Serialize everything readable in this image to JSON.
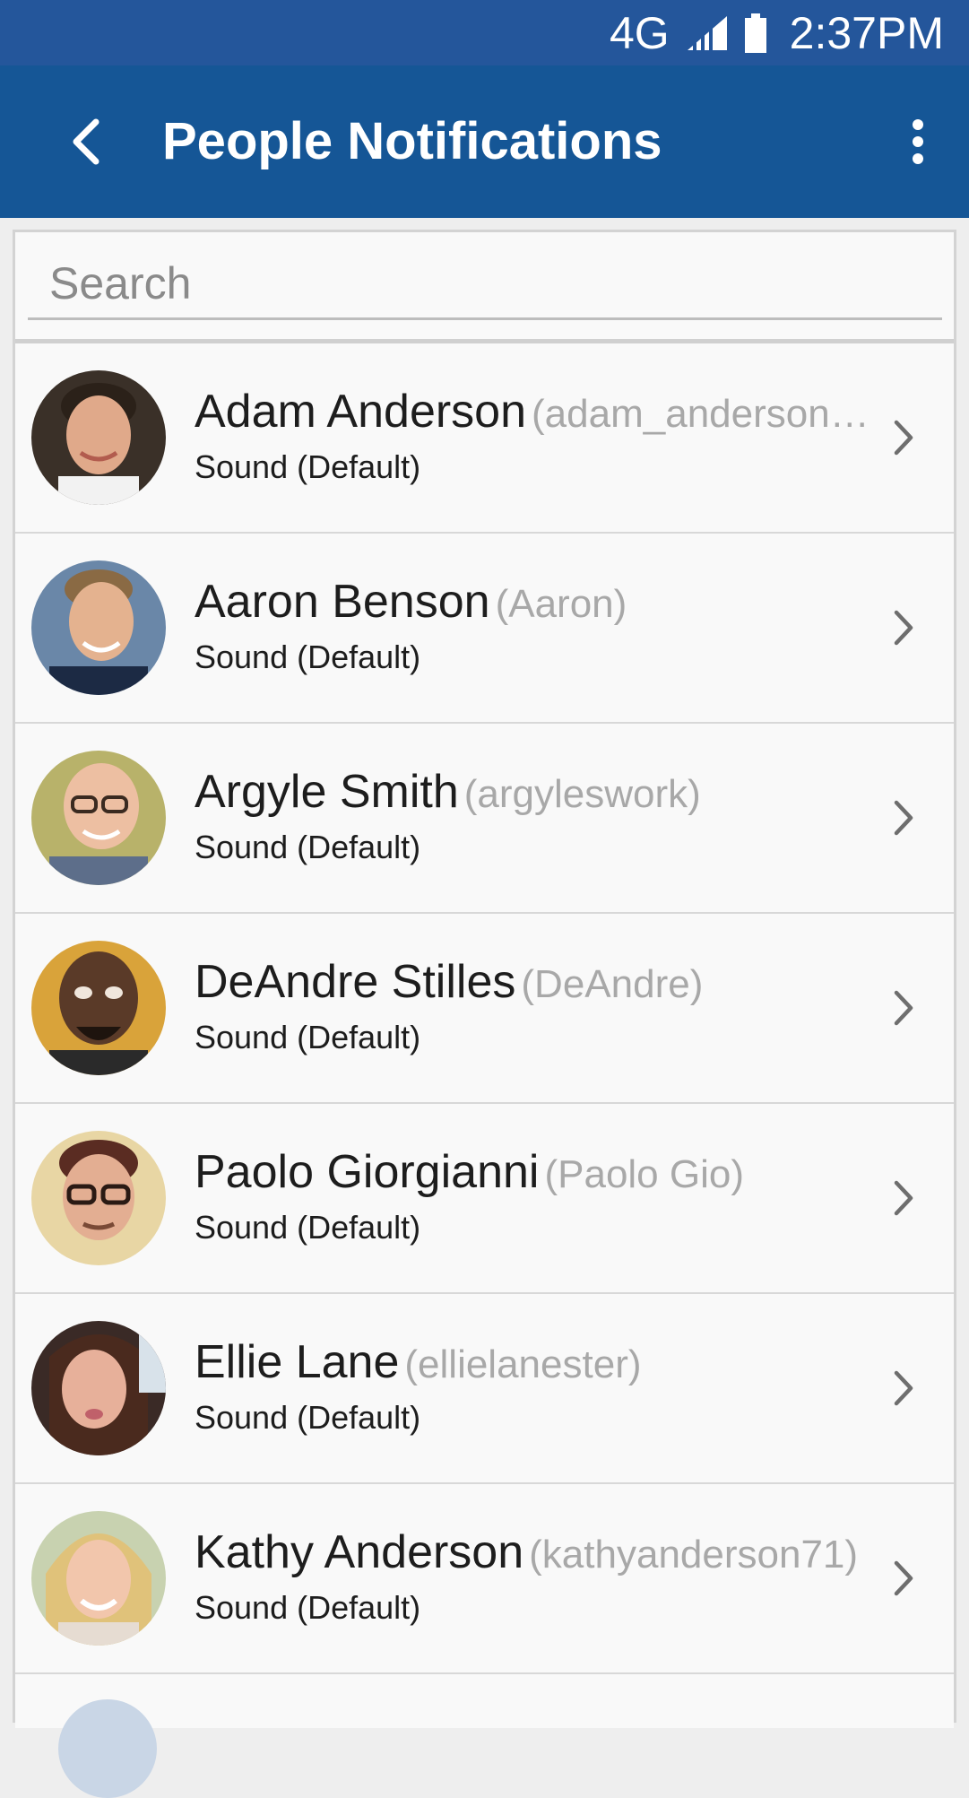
{
  "status_bar": {
    "network": "4G",
    "time": "2:37PM"
  },
  "app_bar": {
    "title": "People Notifications"
  },
  "search": {
    "placeholder": "Search",
    "value": ""
  },
  "people": [
    {
      "name": "Adam Anderson",
      "handle": "(adam_anderson…",
      "sound": "Sound (Default)"
    },
    {
      "name": "Aaron Benson",
      "handle": "(Aaron)",
      "sound": "Sound (Default)"
    },
    {
      "name": "Argyle Smith",
      "handle": "(argyleswork)",
      "sound": "Sound (Default)"
    },
    {
      "name": "DeAndre Stilles",
      "handle": "(DeAndre)",
      "sound": "Sound (Default)"
    },
    {
      "name": "Paolo Giorgianni",
      "handle": "(Paolo Gio)",
      "sound": "Sound (Default)"
    },
    {
      "name": "Ellie Lane",
      "handle": "(ellielanester)",
      "sound": "Sound (Default)"
    },
    {
      "name": "Kathy Anderson",
      "handle": "(kathyanderson71)",
      "sound": "Sound (Default)"
    }
  ],
  "icons": {
    "back": "back-arrow-icon",
    "overflow": "more-vert-icon",
    "row_chevron": "chevron-right-icon",
    "signal": "signal-icon",
    "battery": "battery-icon"
  },
  "colors": {
    "status_bar": "#24569b",
    "app_bar": "#155696",
    "list_background": "#f9f9f9",
    "secondary_text": "#a8a8a8"
  }
}
